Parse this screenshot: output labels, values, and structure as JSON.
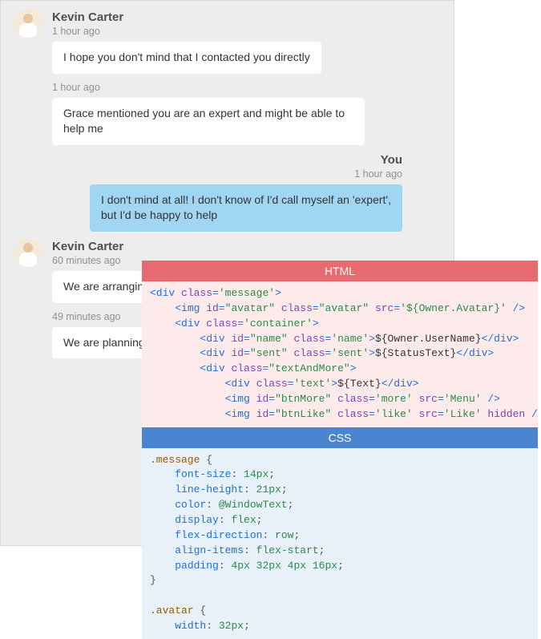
{
  "chat": {
    "groups": [
      {
        "kind": "incoming",
        "author": "Kevin Carter",
        "timestamp": "1 hour ago",
        "bubbles": [
          {
            "time": null,
            "text": "I hope you don't mind that I contacted you directly"
          },
          {
            "time": "1 hour ago",
            "text": "Grace mentioned you are an expert and might be able to help me"
          }
        ]
      },
      {
        "kind": "outgoing",
        "author": "You",
        "timestamp": "1 hour ago",
        "bubbles": [
          {
            "time": null,
            "text": "I don't mind at all! I don't know of I'd call myself an 'expert', but I'd be happy to help"
          }
        ]
      },
      {
        "kind": "incoming",
        "author": "Kevin Carter",
        "timestamp": "60 minutes ago",
        "bubbles": [
          {
            "time": null,
            "text": "We are arranging"
          },
          {
            "time": "49 minutes ago",
            "text": "We are planning\nvarying degrees"
          }
        ]
      }
    ]
  },
  "overlay": {
    "html_title": "HTML",
    "css_title": "CSS",
    "html_lines": [
      [
        [
          "t-tag",
          "<div "
        ],
        [
          "t-attr",
          "class"
        ],
        [
          "t-tag",
          "="
        ],
        [
          "t-str",
          "'message'"
        ],
        [
          "t-tag",
          ">"
        ]
      ],
      [
        [
          "t-plain",
          "    "
        ],
        [
          "t-tag",
          "<img "
        ],
        [
          "t-attr",
          "id"
        ],
        [
          "t-tag",
          "="
        ],
        [
          "t-str",
          "\"avatar\""
        ],
        [
          "t-tag",
          " "
        ],
        [
          "t-attr",
          "class"
        ],
        [
          "t-tag",
          "="
        ],
        [
          "t-str",
          "\"avatar\""
        ],
        [
          "t-tag",
          " "
        ],
        [
          "t-attr",
          "src"
        ],
        [
          "t-tag",
          "="
        ],
        [
          "t-str",
          "'${Owner.Avatar}'"
        ],
        [
          "t-tag",
          " />"
        ]
      ],
      [
        [
          "t-plain",
          "    "
        ],
        [
          "t-tag",
          "<div "
        ],
        [
          "t-attr",
          "class"
        ],
        [
          "t-tag",
          "="
        ],
        [
          "t-str",
          "'container'"
        ],
        [
          "t-tag",
          ">"
        ]
      ],
      [
        [
          "t-plain",
          "        "
        ],
        [
          "t-tag",
          "<div "
        ],
        [
          "t-attr",
          "id"
        ],
        [
          "t-tag",
          "="
        ],
        [
          "t-str",
          "\"name\""
        ],
        [
          "t-tag",
          " "
        ],
        [
          "t-attr",
          "class"
        ],
        [
          "t-tag",
          "="
        ],
        [
          "t-str",
          "'name'"
        ],
        [
          "t-tag",
          ">"
        ],
        [
          "t-plain",
          "${Owner.UserName}"
        ],
        [
          "t-tag",
          "</div>"
        ]
      ],
      [
        [
          "t-plain",
          "        "
        ],
        [
          "t-tag",
          "<div "
        ],
        [
          "t-attr",
          "id"
        ],
        [
          "t-tag",
          "="
        ],
        [
          "t-str",
          "\"sent\""
        ],
        [
          "t-tag",
          " "
        ],
        [
          "t-attr",
          "class"
        ],
        [
          "t-tag",
          "="
        ],
        [
          "t-str",
          "'sent'"
        ],
        [
          "t-tag",
          ">"
        ],
        [
          "t-plain",
          "${StatusText}"
        ],
        [
          "t-tag",
          "</div>"
        ]
      ],
      [
        [
          "t-plain",
          "        "
        ],
        [
          "t-tag",
          "<div "
        ],
        [
          "t-attr",
          "class"
        ],
        [
          "t-tag",
          "="
        ],
        [
          "t-str",
          "\"textAndMore\""
        ],
        [
          "t-tag",
          ">"
        ]
      ],
      [
        [
          "t-plain",
          "            "
        ],
        [
          "t-tag",
          "<div "
        ],
        [
          "t-attr",
          "class"
        ],
        [
          "t-tag",
          "="
        ],
        [
          "t-str",
          "'text'"
        ],
        [
          "t-tag",
          ">"
        ],
        [
          "t-plain",
          "${Text}"
        ],
        [
          "t-tag",
          "</div>"
        ]
      ],
      [
        [
          "t-plain",
          "            "
        ],
        [
          "t-tag",
          "<img "
        ],
        [
          "t-attr",
          "id"
        ],
        [
          "t-tag",
          "="
        ],
        [
          "t-str",
          "\"btnMore\""
        ],
        [
          "t-tag",
          " "
        ],
        [
          "t-attr",
          "class"
        ],
        [
          "t-tag",
          "="
        ],
        [
          "t-str",
          "'more'"
        ],
        [
          "t-tag",
          " "
        ],
        [
          "t-attr",
          "src"
        ],
        [
          "t-tag",
          "="
        ],
        [
          "t-str",
          "'Menu'"
        ],
        [
          "t-tag",
          " />"
        ]
      ],
      [
        [
          "t-plain",
          "            "
        ],
        [
          "t-tag",
          "<img "
        ],
        [
          "t-attr",
          "id"
        ],
        [
          "t-tag",
          "="
        ],
        [
          "t-str",
          "\"btnLike\""
        ],
        [
          "t-tag",
          " "
        ],
        [
          "t-attr",
          "class"
        ],
        [
          "t-tag",
          "="
        ],
        [
          "t-str",
          "'like'"
        ],
        [
          "t-tag",
          " "
        ],
        [
          "t-attr",
          "src"
        ],
        [
          "t-tag",
          "="
        ],
        [
          "t-str",
          "'Like'"
        ],
        [
          "t-tag",
          " "
        ],
        [
          "t-attr",
          "hidden"
        ],
        [
          "t-tag",
          " />"
        ]
      ]
    ],
    "css_lines": [
      [
        [
          "t-sel",
          ".message "
        ],
        [
          "t-punct",
          "{"
        ]
      ],
      [
        [
          "t-plain",
          "    "
        ],
        [
          "t-prop",
          "font-size"
        ],
        [
          "t-punct",
          ": "
        ],
        [
          "t-val",
          "14px"
        ],
        [
          "t-punct",
          ";"
        ]
      ],
      [
        [
          "t-plain",
          "    "
        ],
        [
          "t-prop",
          "line-height"
        ],
        [
          "t-punct",
          ": "
        ],
        [
          "t-val",
          "21px"
        ],
        [
          "t-punct",
          ";"
        ]
      ],
      [
        [
          "t-plain",
          "    "
        ],
        [
          "t-prop",
          "color"
        ],
        [
          "t-punct",
          ": "
        ],
        [
          "t-val",
          "@WindowText"
        ],
        [
          "t-punct",
          ";"
        ]
      ],
      [
        [
          "t-plain",
          "    "
        ],
        [
          "t-prop",
          "display"
        ],
        [
          "t-punct",
          ": "
        ],
        [
          "t-val",
          "flex"
        ],
        [
          "t-punct",
          ";"
        ]
      ],
      [
        [
          "t-plain",
          "    "
        ],
        [
          "t-prop",
          "flex-direction"
        ],
        [
          "t-punct",
          ": "
        ],
        [
          "t-val",
          "row"
        ],
        [
          "t-punct",
          ";"
        ]
      ],
      [
        [
          "t-plain",
          "    "
        ],
        [
          "t-prop",
          "align-items"
        ],
        [
          "t-punct",
          ": "
        ],
        [
          "t-val",
          "flex-start"
        ],
        [
          "t-punct",
          ";"
        ]
      ],
      [
        [
          "t-plain",
          "    "
        ],
        [
          "t-prop",
          "padding"
        ],
        [
          "t-punct",
          ": "
        ],
        [
          "t-val",
          "4px 32px 4px 16px"
        ],
        [
          "t-punct",
          ";"
        ]
      ],
      [
        [
          "t-punct",
          "}"
        ]
      ],
      [
        [
          "t-plain",
          " "
        ]
      ],
      [
        [
          "t-sel",
          ".avatar "
        ],
        [
          "t-punct",
          "{"
        ]
      ],
      [
        [
          "t-plain",
          "    "
        ],
        [
          "t-prop",
          "width"
        ],
        [
          "t-punct",
          ": "
        ],
        [
          "t-val",
          "32px"
        ],
        [
          "t-punct",
          ";"
        ]
      ]
    ]
  }
}
